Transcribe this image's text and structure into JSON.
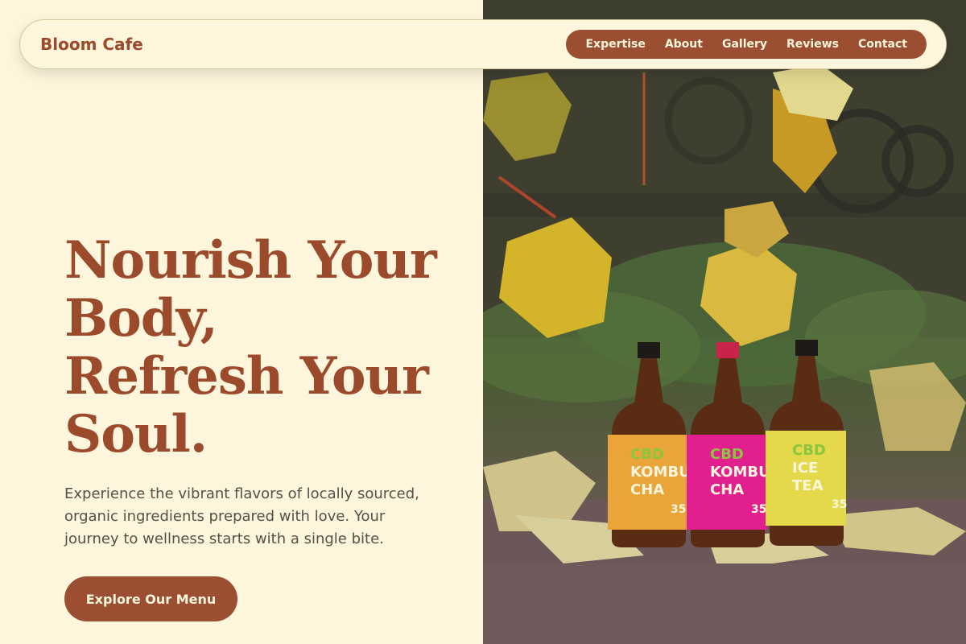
{
  "header": {
    "brand": "Bloom Cafe",
    "nav": [
      "Expertise",
      "About",
      "Gallery",
      "Reviews",
      "Contact"
    ]
  },
  "hero": {
    "headline_lines": [
      "Nourish Your",
      "Body,",
      "Refresh Your",
      "Soul."
    ],
    "subtext": "Experience the vibrant flavors of locally sourced, organic ingredients prepared with love. Your journey to wellness starts with a single bite.",
    "cta_label": "Explore Our Menu"
  },
  "image": {
    "bottles": [
      {
        "line1": "CBD",
        "line2": "KOMBU",
        "line3": "CHA",
        "number": "35"
      },
      {
        "line1": "CBD",
        "line2": "KOMBU",
        "line3": "CHA",
        "number": "35"
      },
      {
        "line1": "CBD",
        "line2": "ICE",
        "line3": "TEA",
        "number": "35"
      }
    ]
  },
  "colors": {
    "background": "#fdf6dc",
    "accent": "#9b4e31",
    "heading": "#9b4a2b",
    "body_text": "#555048"
  }
}
